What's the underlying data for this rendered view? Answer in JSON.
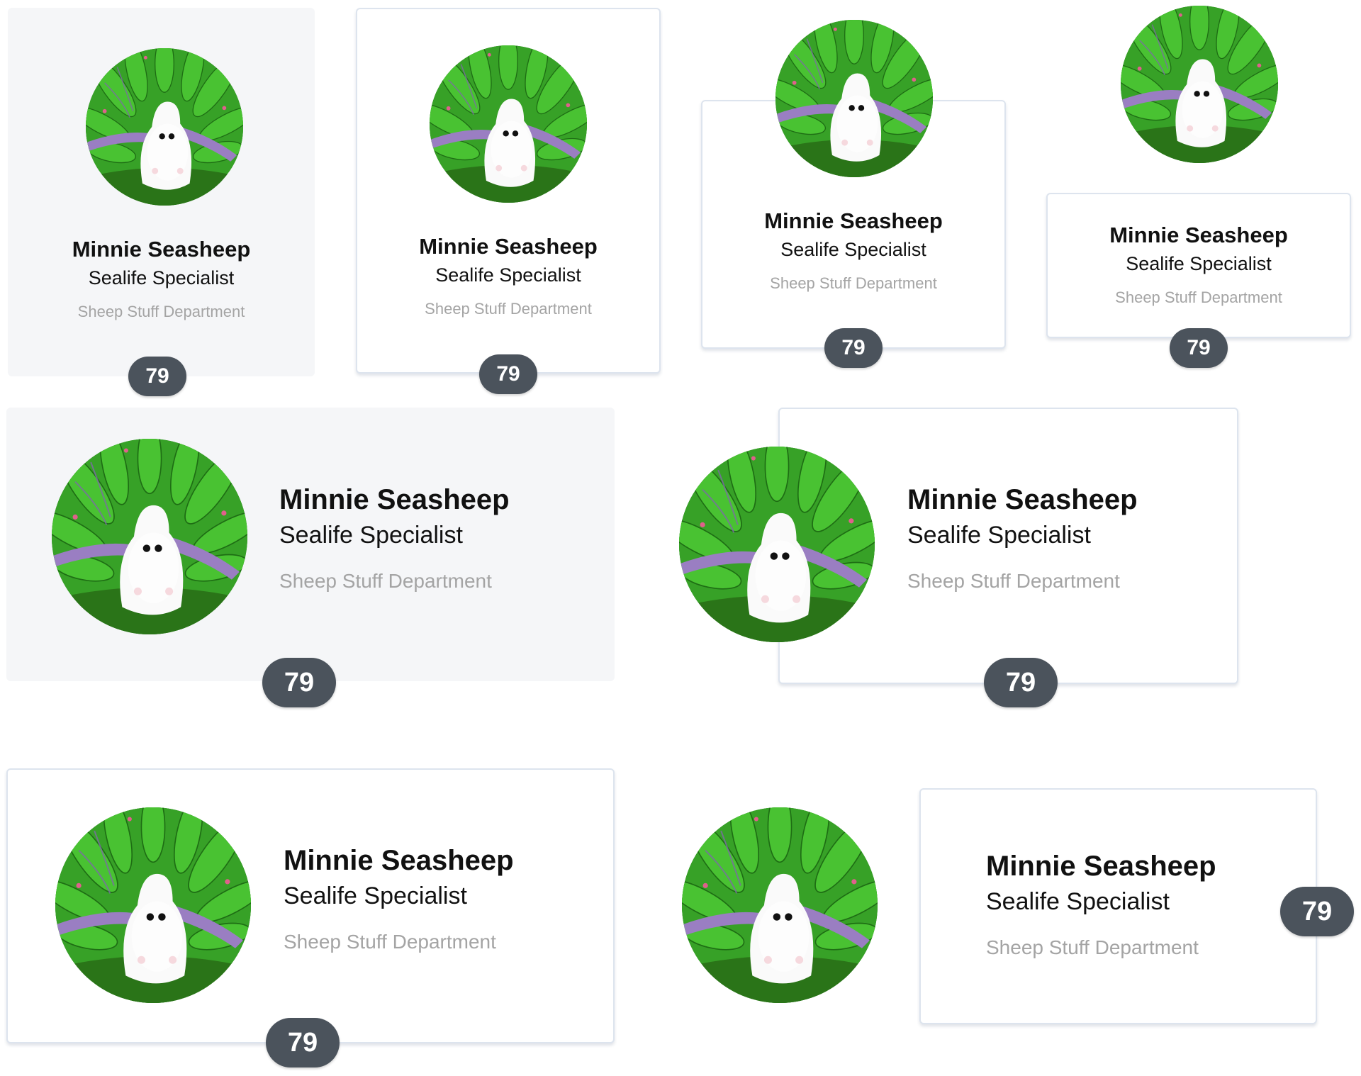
{
  "profile": {
    "name": "Minnie Seasheep",
    "title": "Sealife Specialist",
    "department": "Sheep Stuff Department",
    "score": "79"
  },
  "variants": [
    {
      "id": "vertical-flat",
      "badge_position": "bottom"
    },
    {
      "id": "vertical-outlined",
      "badge_position": "bottom"
    },
    {
      "id": "vertical-outlined-overlap-avatar",
      "badge_position": "bottom"
    },
    {
      "id": "vertical-floating-avatar",
      "badge_position": "bottom"
    },
    {
      "id": "horizontal-flat",
      "badge_position": "bottom"
    },
    {
      "id": "horizontal-outlined-overlap-avatar",
      "badge_position": "bottom"
    },
    {
      "id": "horizontal-outlined",
      "badge_position": "bottom"
    },
    {
      "id": "horizontal-floating-avatar",
      "badge_position": "right"
    }
  ],
  "colors": {
    "flat_card_bg": "#f5f6f8",
    "card_border": "#dde4ee",
    "badge_bg": "#4b535c",
    "badge_text": "#ffffff",
    "department_text": "#a4a4a4"
  },
  "icons": {
    "avatar": "sea-sheep-avatar-image"
  }
}
